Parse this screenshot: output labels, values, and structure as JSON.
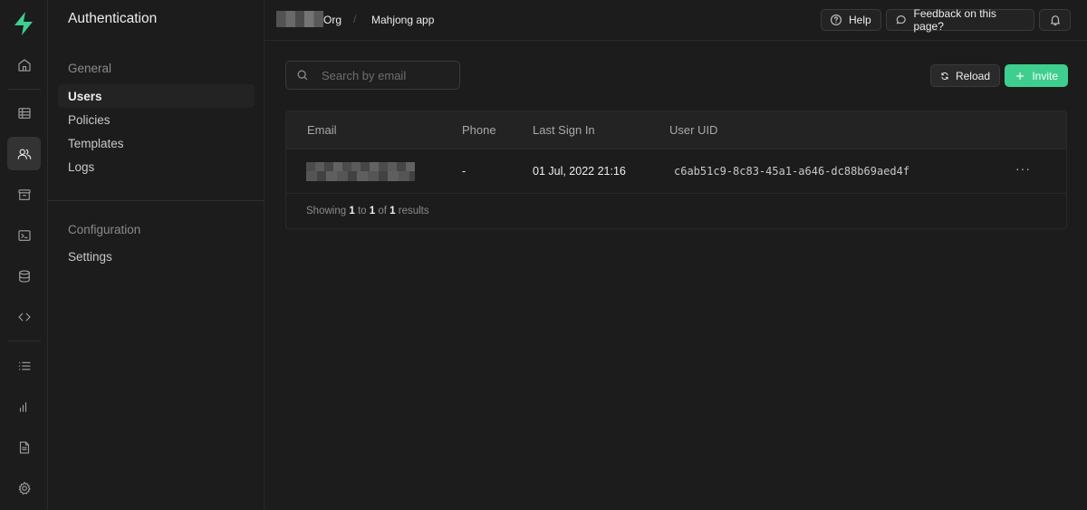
{
  "sidebar": {
    "title": "Authentication",
    "groups": [
      {
        "label": "General",
        "items": [
          {
            "label": "Users",
            "active": true
          },
          {
            "label": "Policies"
          },
          {
            "label": "Templates"
          },
          {
            "label": "Logs"
          }
        ]
      },
      {
        "label": "Configuration",
        "items": [
          {
            "label": "Settings"
          }
        ]
      }
    ]
  },
  "rail": {
    "icons": [
      "home-icon",
      "table-editor-icon",
      "users-icon",
      "storage-icon",
      "sql-editor-icon",
      "database-icon",
      "api-icon",
      "logs-list-icon",
      "reports-icon",
      "docs-icon",
      "settings-icon"
    ],
    "active": "users-icon"
  },
  "topbar": {
    "org_suffix": "Org",
    "project": "Mahjong app",
    "help_label": "Help",
    "feedback_label": "Feedback on this page?"
  },
  "search": {
    "placeholder": "Search by email",
    "value": ""
  },
  "actions": {
    "reload_label": "Reload",
    "invite_label": "Invite"
  },
  "table": {
    "columns": [
      "Email",
      "Phone",
      "Last Sign In",
      "User UID"
    ],
    "rows": [
      {
        "email": "",
        "phone": "-",
        "last_sign_in": "01 Jul, 2022 21:16",
        "uid": "c6ab51c9-8c83-45a1-a646-dc88b69aed4f"
      }
    ],
    "footer": {
      "prefix": "Showing",
      "from": "1",
      "to_word": "to",
      "to": "1",
      "of_word": "of",
      "total": "1",
      "suffix": "results"
    }
  },
  "colors": {
    "accent": "#3ecf8e",
    "background": "#1c1c1c"
  }
}
